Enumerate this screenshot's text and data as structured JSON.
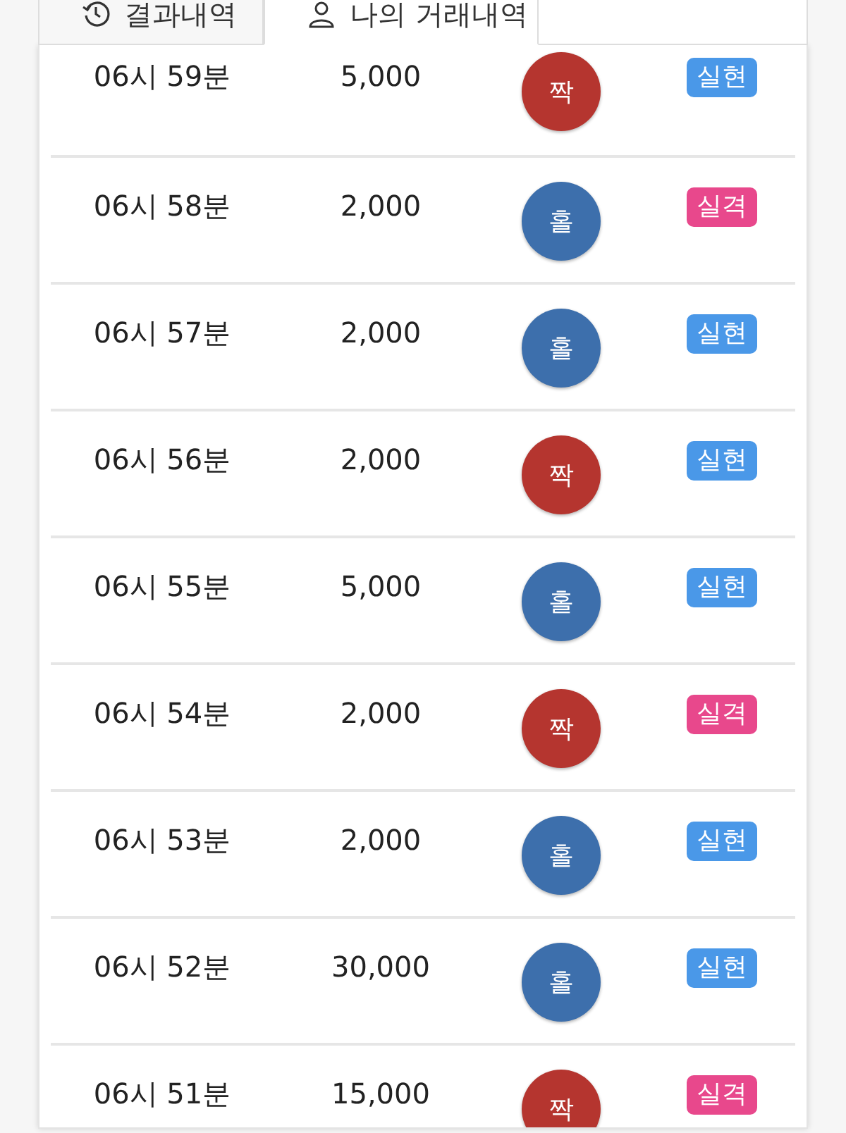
{
  "tabs": [
    {
      "label": "결과내역",
      "kind": "history",
      "selected": false
    },
    {
      "label": "나의 거래내역",
      "kind": "account",
      "selected": true
    }
  ],
  "rows": [
    {
      "time": "06시 59분",
      "amount": "5,000",
      "pick": {
        "label": "짝",
        "color": "#b5352f"
      },
      "result": {
        "label": "실현",
        "color": "#4a98e8"
      }
    },
    {
      "time": "06시 58분",
      "amount": "2,000",
      "pick": {
        "label": "홀",
        "color": "#3d6fac"
      },
      "result": {
        "label": "실격",
        "color": "#e8488c"
      }
    },
    {
      "time": "06시 57분",
      "amount": "2,000",
      "pick": {
        "label": "홀",
        "color": "#3d6fac"
      },
      "result": {
        "label": "실현",
        "color": "#4a98e8"
      }
    },
    {
      "time": "06시 56분",
      "amount": "2,000",
      "pick": {
        "label": "짝",
        "color": "#b5352f"
      },
      "result": {
        "label": "실현",
        "color": "#4a98e8"
      }
    },
    {
      "time": "06시 55분",
      "amount": "5,000",
      "pick": {
        "label": "홀",
        "color": "#3d6fac"
      },
      "result": {
        "label": "실현",
        "color": "#4a98e8"
      }
    },
    {
      "time": "06시 54분",
      "amount": "2,000",
      "pick": {
        "label": "짝",
        "color": "#b5352f"
      },
      "result": {
        "label": "실격",
        "color": "#e8488c"
      }
    },
    {
      "time": "06시 53분",
      "amount": "2,000",
      "pick": {
        "label": "홀",
        "color": "#3d6fac"
      },
      "result": {
        "label": "실현",
        "color": "#4a98e8"
      }
    },
    {
      "time": "06시 52분",
      "amount": "30,000",
      "pick": {
        "label": "홀",
        "color": "#3d6fac"
      },
      "result": {
        "label": "실현",
        "color": "#4a98e8"
      }
    },
    {
      "time": "06시 51분",
      "amount": "15,000",
      "pick": {
        "label": "짝",
        "color": "#b5352f"
      },
      "result": {
        "label": "실격",
        "color": "#e8488c"
      }
    }
  ]
}
